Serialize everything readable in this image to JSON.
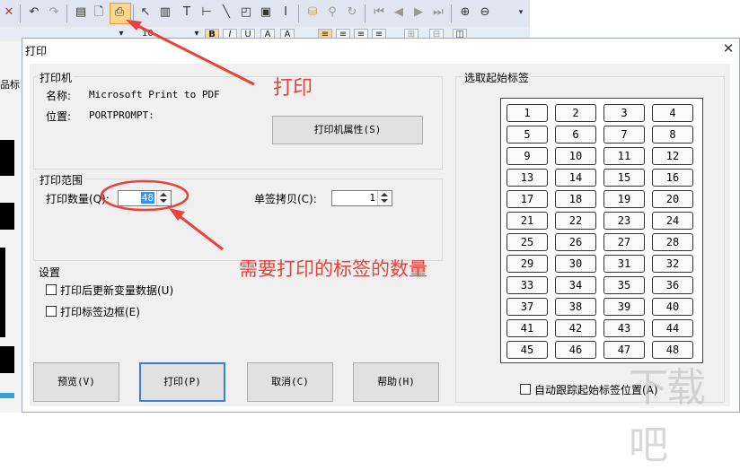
{
  "dialog": {
    "title": "打印",
    "close_glyph": "✕"
  },
  "printer": {
    "group_label": "打印机",
    "name_label": "名称:",
    "name_value": "Microsoft Print to PDF",
    "location_label": "位置:",
    "location_value": "PORTPROMPT:",
    "properties_button": "打印机属性(S)"
  },
  "range": {
    "group_label": "打印范围",
    "quantity_label": "打印数量(Q):",
    "quantity_value": "48",
    "copies_label": "单签拷贝(C):",
    "copies_value": "1"
  },
  "settings": {
    "group_label": "设置",
    "update_vars_label": "打印后更新变量数据(U)",
    "print_border_label": "打印标签边框(E)"
  },
  "start_label": {
    "group_label": "选取起始标签",
    "cells": [
      "1",
      "2",
      "3",
      "4",
      "5",
      "6",
      "7",
      "8",
      "9",
      "10",
      "11",
      "12",
      "13",
      "14",
      "15",
      "16",
      "17",
      "18",
      "19",
      "20",
      "21",
      "22",
      "23",
      "24",
      "25",
      "26",
      "27",
      "28",
      "29",
      "30",
      "31",
      "32",
      "33",
      "34",
      "35",
      "36",
      "37",
      "38",
      "39",
      "40",
      "41",
      "42",
      "43",
      "44",
      "45",
      "46",
      "47",
      "48"
    ],
    "auto_track_label": "自动跟踪起始标签位置(A)"
  },
  "buttons": {
    "preview": "预览(V)",
    "print": "打印(P)",
    "cancel": "取消(C)",
    "help": "帮助(H)"
  },
  "annotations": {
    "print_callout": "打印",
    "quantity_callout": "需要打印的标签的数量",
    "color": "#e8423a"
  },
  "background": {
    "zoom_value": "10",
    "side_label": "品标"
  },
  "watermark": "下载吧"
}
